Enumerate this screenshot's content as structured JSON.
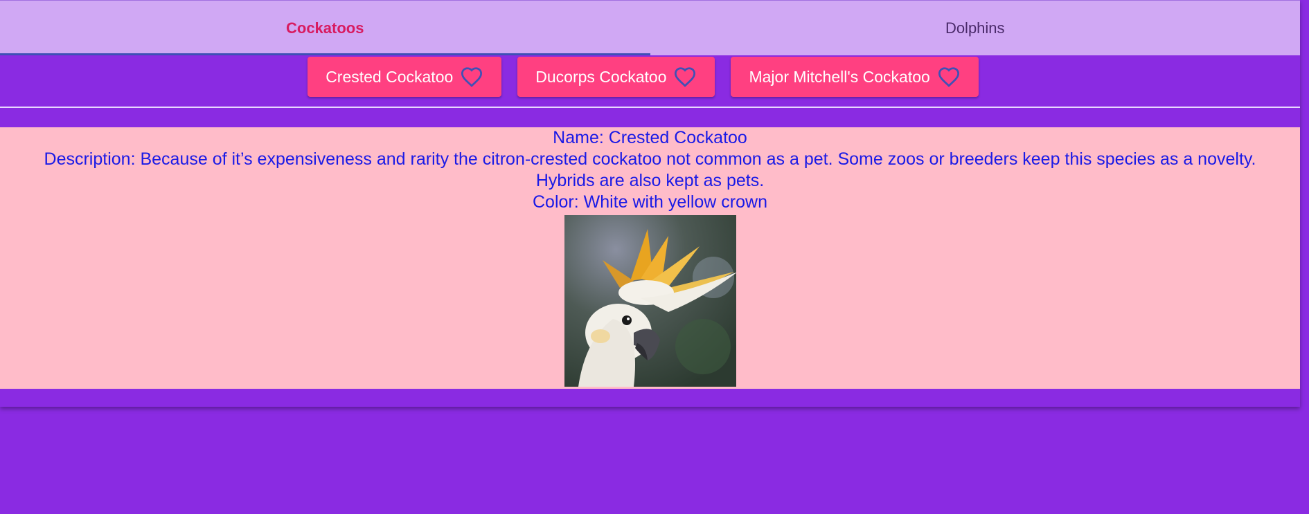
{
  "tabs": [
    {
      "label": "Cockatoos",
      "active": true
    },
    {
      "label": "Dolphins",
      "active": false
    }
  ],
  "chips": [
    {
      "label": "Crested Cockatoo",
      "icon": "heart-outline-icon"
    },
    {
      "label": "Ducorps Cockatoo",
      "icon": "heart-outline-icon"
    },
    {
      "label": "Major Mitchell's Cockatoo",
      "icon": "heart-outline-icon"
    }
  ],
  "detail": {
    "name": "Name: Crested Cockatoo",
    "description_line1": "Description: Because of it’s expensiveness and rarity the citron-crested cockatoo not common as a pet. Some zoos or breeders keep this species as a novelty.",
    "description_line2": "Hybrids are also kept as pets.",
    "color": "Color: White with yellow crown"
  },
  "colors": {
    "background": "#8a2be2",
    "tabbar": "#d0a8f4",
    "active_tab_text": "#d81b60",
    "tab_indicator": "#3f51b5",
    "chip": "#ff4081",
    "heart": "#3f51b5",
    "detail_bg": "#ffbcc9",
    "detail_text": "#1a1ae6"
  }
}
